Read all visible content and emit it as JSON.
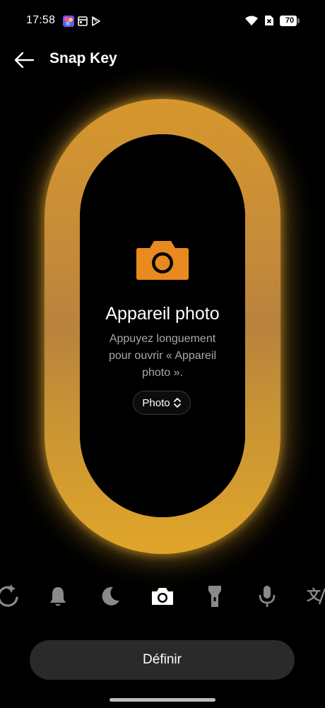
{
  "status_bar": {
    "time": "17:58",
    "battery_level": "70"
  },
  "header": {
    "title": "Snap Key"
  },
  "feature": {
    "title": "Appareil photo",
    "description": "Appuyez longuement pour ouvrir « Appareil photo ».",
    "mode_value": "Photo",
    "icon": "camera-icon"
  },
  "actions_row": {
    "items": [
      {
        "icon": "assistant-refresh-icon",
        "selected": false
      },
      {
        "icon": "bell-icon",
        "selected": false
      },
      {
        "icon": "moon-icon",
        "selected": false
      },
      {
        "icon": "camera-icon",
        "selected": true
      },
      {
        "icon": "flashlight-icon",
        "selected": false
      },
      {
        "icon": "microphone-icon",
        "selected": false
      },
      {
        "icon": "translate-icon",
        "selected": false
      }
    ]
  },
  "bottom": {
    "define_label": "Définir"
  },
  "colors": {
    "accent": "#e88a1f",
    "capsule": "#d7972d",
    "background": "#000000"
  }
}
